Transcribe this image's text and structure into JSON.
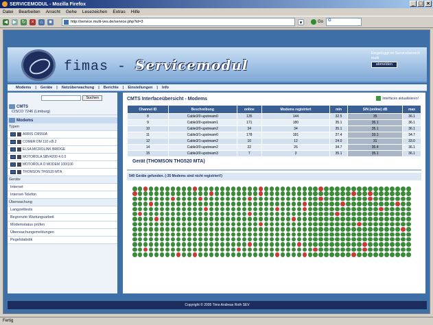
{
  "window": {
    "title": "SERVICEMODUL - Mozilla Firefox",
    "controls": [
      "_",
      "□",
      "×"
    ]
  },
  "menubar": {
    "items": [
      "Datei",
      "Bearbeiten",
      "Ansicht",
      "Gehe",
      "Lesezeichen",
      "Extras",
      "Hilfe"
    ]
  },
  "toolbar": {
    "url": "http://service.multi-ves.de/service.php?id=3",
    "go_label": "Go",
    "search_prefix": "G"
  },
  "header": {
    "brand_left": "fimas -",
    "brand_right": "Servicemodul",
    "login_label": "Eingeloggt im Servicebereich",
    "user": "multi",
    "logout_label": "abmelden"
  },
  "nav": {
    "items": [
      "Modems",
      "Geräte",
      "Netzüberwachung",
      "Berichte",
      "Einstellungen",
      "Info"
    ]
  },
  "sidebar": {
    "search_button": "Suchen",
    "cmts_head": "CMTS",
    "cmts_item": "CISCO 7246 (Limburg)",
    "modems_head": "Modems",
    "types_label": "Typen",
    "types": [
      "ARRIS CM550A",
      "COMER DM 110 v.B.2",
      "ELSA MICROLINK BRIDGE",
      "MOTOROLA SBV4200 4.0.0",
      "MOTOROLA O MODEM 100/100",
      "THOMSON THG520 MTA"
    ],
    "geraete_label": "Geräte",
    "geraete": [
      "Internet",
      "Internet-Telefon"
    ],
    "ueberwachung_label": "Überwachung",
    "ueberwachung": [
      "Langzeittests",
      "Begrenzte Wartungsarbeit",
      "Modemstatus prüfen",
      "Überwachungsmeldungen",
      "Pegelstatistik"
    ]
  },
  "main": {
    "title": "CMTS Interfaceübersicht - Modems",
    "iface_link": "Interfaces aktualisieren!",
    "columns": [
      "Channel ID",
      "Beschreibung",
      "online",
      "Modems registriert",
      "min",
      "S/N (online) dB",
      "max"
    ],
    "rows": [
      [
        "8",
        "Cable3/0-upstream0",
        "135",
        "144",
        "32.5",
        "35",
        "36.1"
      ],
      [
        "9",
        "Cable3/0-upstream1",
        "171",
        "180",
        "35.1",
        "35.1",
        "36.1"
      ],
      [
        "10",
        "Cable3/0-upstream2",
        "34",
        "34",
        "35.1",
        "35.1",
        "36.1"
      ],
      [
        "11",
        "Cable3/1-upstream0",
        "178",
        "181",
        "27.4",
        "33.1",
        "34.7"
      ],
      [
        "12",
        "Cable3/1-upstream2",
        "10",
        "12",
        "24.0",
        "31",
        "33.0"
      ],
      [
        "14",
        "Cable3/0-upstream2",
        "22",
        "26",
        "34.7",
        "35.4",
        "36.1"
      ],
      [
        "15",
        "Cable3/0-upstream3",
        "7",
        "3",
        "35.1",
        "35.1",
        "36.1"
      ]
    ],
    "device_title": "Gerät (THOMSON THG520 MTA)",
    "found_text": "540 Geräte gefunden. (-35 Modems sind nicht registriert!)",
    "grid_pattern": "1101111111101111111111101111111111011111111111111110111111111111101111111101111111111111111011011111111111111011110111111110111111111111011111111011111111110111111111111111111111111111011111101111111110111111111111111011111111111101111011111111111110111111011111111111111111110111111111111111011111111111111111011111111111111111111111101111111111111111111111111111111111111111111101111111111111111101111111111111111111111111111111111111111111111111111111111011111111111111111111111111111111111111111111111111111111111111111111111111111111111111111111111111111111111111111111111111"
  },
  "footer": {
    "text": "Copyright © 2005 Timo Andreas Roth SEV"
  },
  "statusbar": {
    "text": "Fertig"
  }
}
